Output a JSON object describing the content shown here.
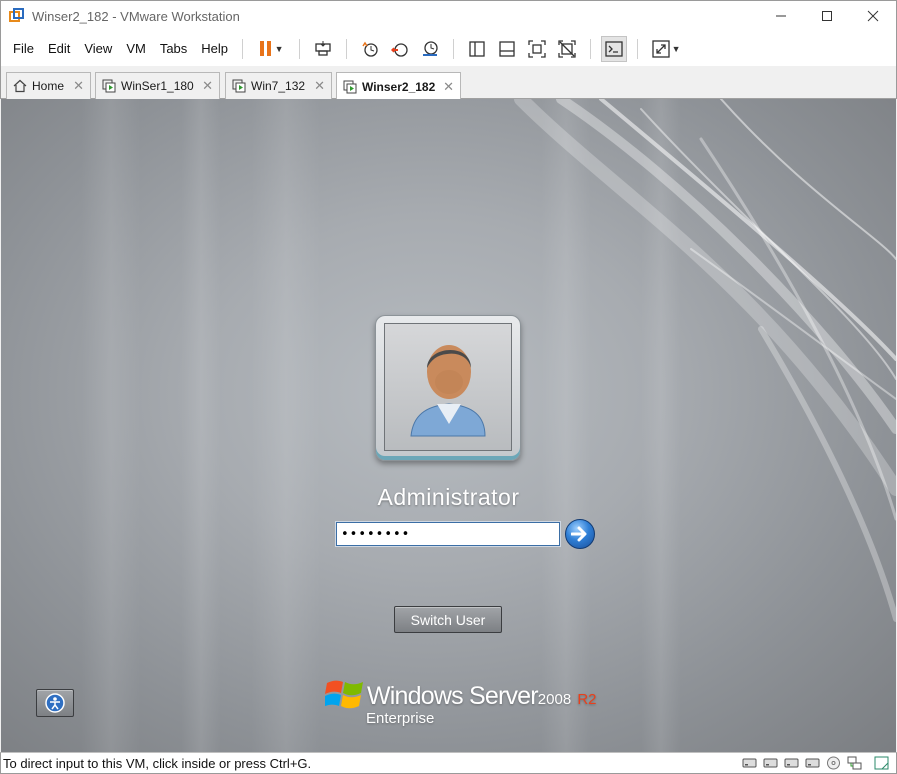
{
  "window": {
    "title": "Winser2_182 - VMware Workstation",
    "controls": [
      "—",
      "☐",
      "✕"
    ]
  },
  "menu": {
    "file": "File",
    "edit": "Edit",
    "view": "View",
    "vm": "VM",
    "tabs": "Tabs",
    "help": "Help"
  },
  "toolbar": {
    "icons": [
      "pause-icon",
      "send-ctrl-alt-del-icon",
      "snapshot-icon",
      "revert-snapshot-icon",
      "snapshot-manager-icon",
      "show-library-icon",
      "thumbnail-bar-icon",
      "fullscreen-icon",
      "unity-icon",
      "console-view-icon",
      "stretch-guest-icon"
    ],
    "accent_pause": "#e8731a"
  },
  "tabs": [
    {
      "label": "Home",
      "icon": "home-icon",
      "active": false
    },
    {
      "label": "WinSer1_180",
      "icon": "vm-icon",
      "active": false
    },
    {
      "label": "Win7_132",
      "icon": "vm-icon",
      "active": false
    },
    {
      "label": "Winser2_182",
      "icon": "vm-icon",
      "active": true
    }
  ],
  "login": {
    "username": "Administrator",
    "password_value": "••••••••",
    "switch_user_label": "Switch User",
    "submit_icon": "arrow-right-icon",
    "ease_of_access_icon": "ease-of-access-icon"
  },
  "branding": {
    "product": "Windows Server",
    "year": "2008",
    "release": "R2",
    "edition": "Enterprise",
    "release_color": "#e8401c"
  },
  "statusbar": {
    "text": "To direct input to this VM, click inside or press Ctrl+G.",
    "icons": [
      "hard-disk-icon",
      "hard-disk-icon",
      "hard-disk-icon",
      "hard-disk-icon",
      "cd-dvd-icon",
      "network-icon",
      "message-log-icon"
    ]
  }
}
